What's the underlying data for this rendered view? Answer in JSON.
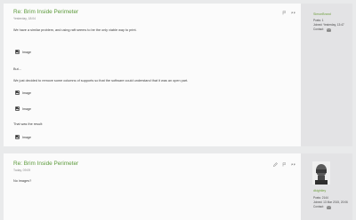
{
  "posts": [
    {
      "title": "Re: Brim Inside Perimeter",
      "meta": "Yesterday, 18:04",
      "lines": {
        "l1": "We have a similar problem, and using raft seems to be the only viable way to print.",
        "l2": "But...",
        "l3": "We just decided to remove some columns of supports so that the software could understand that it was an open part.",
        "l4": "That was the result:"
      },
      "image_label": "Image",
      "user": {
        "name": "SimonBrand",
        "posts": "Posts: 1",
        "joined": "Joined: Yesterday, 13:47",
        "contact": "Contact:"
      }
    },
    {
      "title": "Re: Brim Inside Perimeter",
      "meta": "Today, 09:09",
      "lines": {
        "l1": "No images?"
      },
      "user": {
        "name": "dkightley",
        "posts": "Posts: 2144",
        "joined": "Joined: 13 Mar 2015, 20:06",
        "contact": "Contact:"
      }
    }
  ],
  "icons": {
    "edit": "pencil-icon",
    "report": "flag-icon",
    "quote": "quote-icon",
    "image": "image-icon",
    "contact": "envelope-icon"
  },
  "colors": {
    "title": "#5d9b3c",
    "username": "#6e9f3d",
    "sidebar": "#e3e3e5",
    "page_bg": "#e9eaeb"
  }
}
